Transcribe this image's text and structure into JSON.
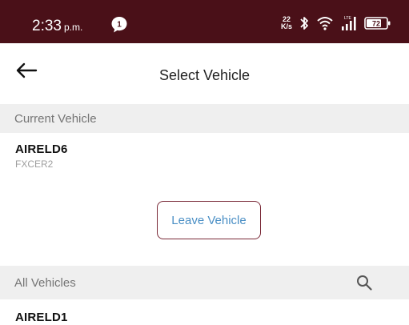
{
  "status_bar": {
    "time": "2:33",
    "ampm": "p.m.",
    "net_speed_value": "22",
    "net_speed_unit": "K/s",
    "lte_label": "LTE",
    "battery": "72",
    "background_color": "#4a1018"
  },
  "header": {
    "title": "Select Vehicle"
  },
  "current_section": {
    "header_label": "Current Vehicle",
    "vehicle_name": "AIRELD6",
    "vehicle_sub": "FXCER2",
    "leave_label": "Leave Vehicle"
  },
  "all_section": {
    "header_label": "All Vehicles",
    "vehicles": [
      {
        "name": "AIRELD1"
      }
    ]
  },
  "colors": {
    "button_border": "#7a2a38",
    "button_text": "#4a8fc5"
  }
}
